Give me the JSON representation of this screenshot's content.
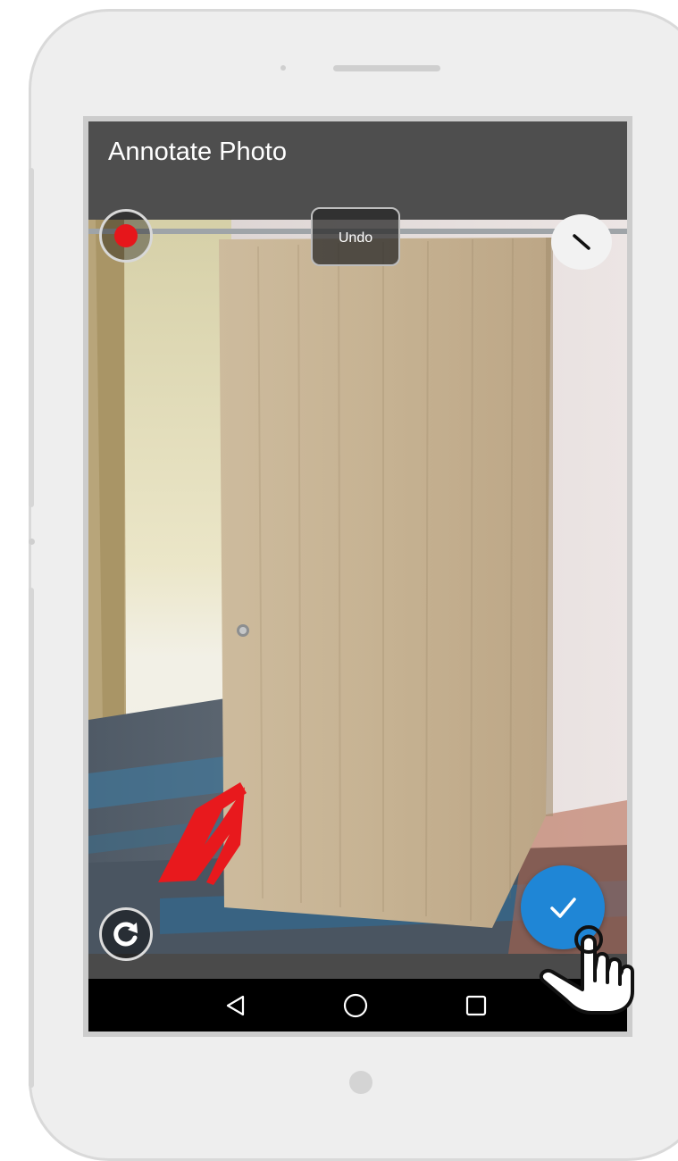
{
  "app": {
    "title": "Annotate Photo"
  },
  "toolbar": {
    "record_icon": "record-dot-icon",
    "record_color": "#e6161b",
    "undo_label": "Undo",
    "line_tool_icon": "line-tool-icon"
  },
  "photo": {
    "annotation_color": "#e8191d"
  },
  "actions": {
    "rotate_icon": "rotate-icon",
    "confirm_icon": "checkmark-icon",
    "confirm_color": "#1f86d6"
  },
  "navbar": {
    "back_icon": "back-triangle-icon",
    "home_icon": "home-circle-icon",
    "recents_icon": "recents-square-icon"
  },
  "overlay": {
    "pointer_icon": "hand-pointer-icon"
  }
}
